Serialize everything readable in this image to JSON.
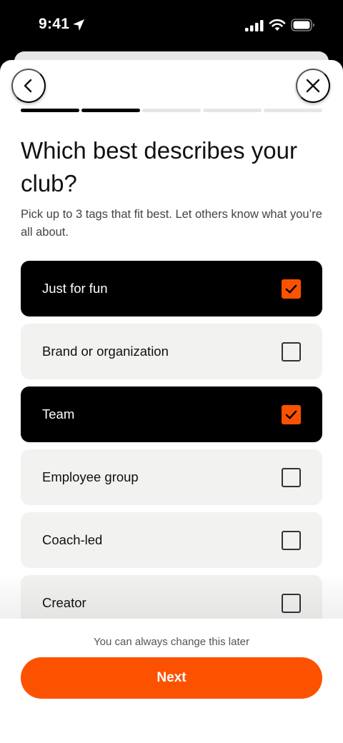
{
  "status_bar": {
    "time": "9:41"
  },
  "header": {
    "back_icon": "chevron-left-icon",
    "close_icon": "close-icon"
  },
  "progress": {
    "total_steps": 5,
    "completed_steps": 2
  },
  "title": "Which best describes your club?",
  "subtitle": "Pick up to 3 tags that fit best. Let others know what you’re all about.",
  "options": [
    {
      "label": "Just for fun",
      "selected": true
    },
    {
      "label": "Brand or organization",
      "selected": false
    },
    {
      "label": "Team",
      "selected": true
    },
    {
      "label": "Employee group",
      "selected": false
    },
    {
      "label": "Coach-led",
      "selected": false
    },
    {
      "label": "Creator",
      "selected": false
    }
  ],
  "footer": {
    "hint": "You can always change this later",
    "next_label": "Next"
  },
  "colors": {
    "accent": "#fc5200",
    "selected_bg": "#000000",
    "option_bg": "#f2f2f1"
  }
}
